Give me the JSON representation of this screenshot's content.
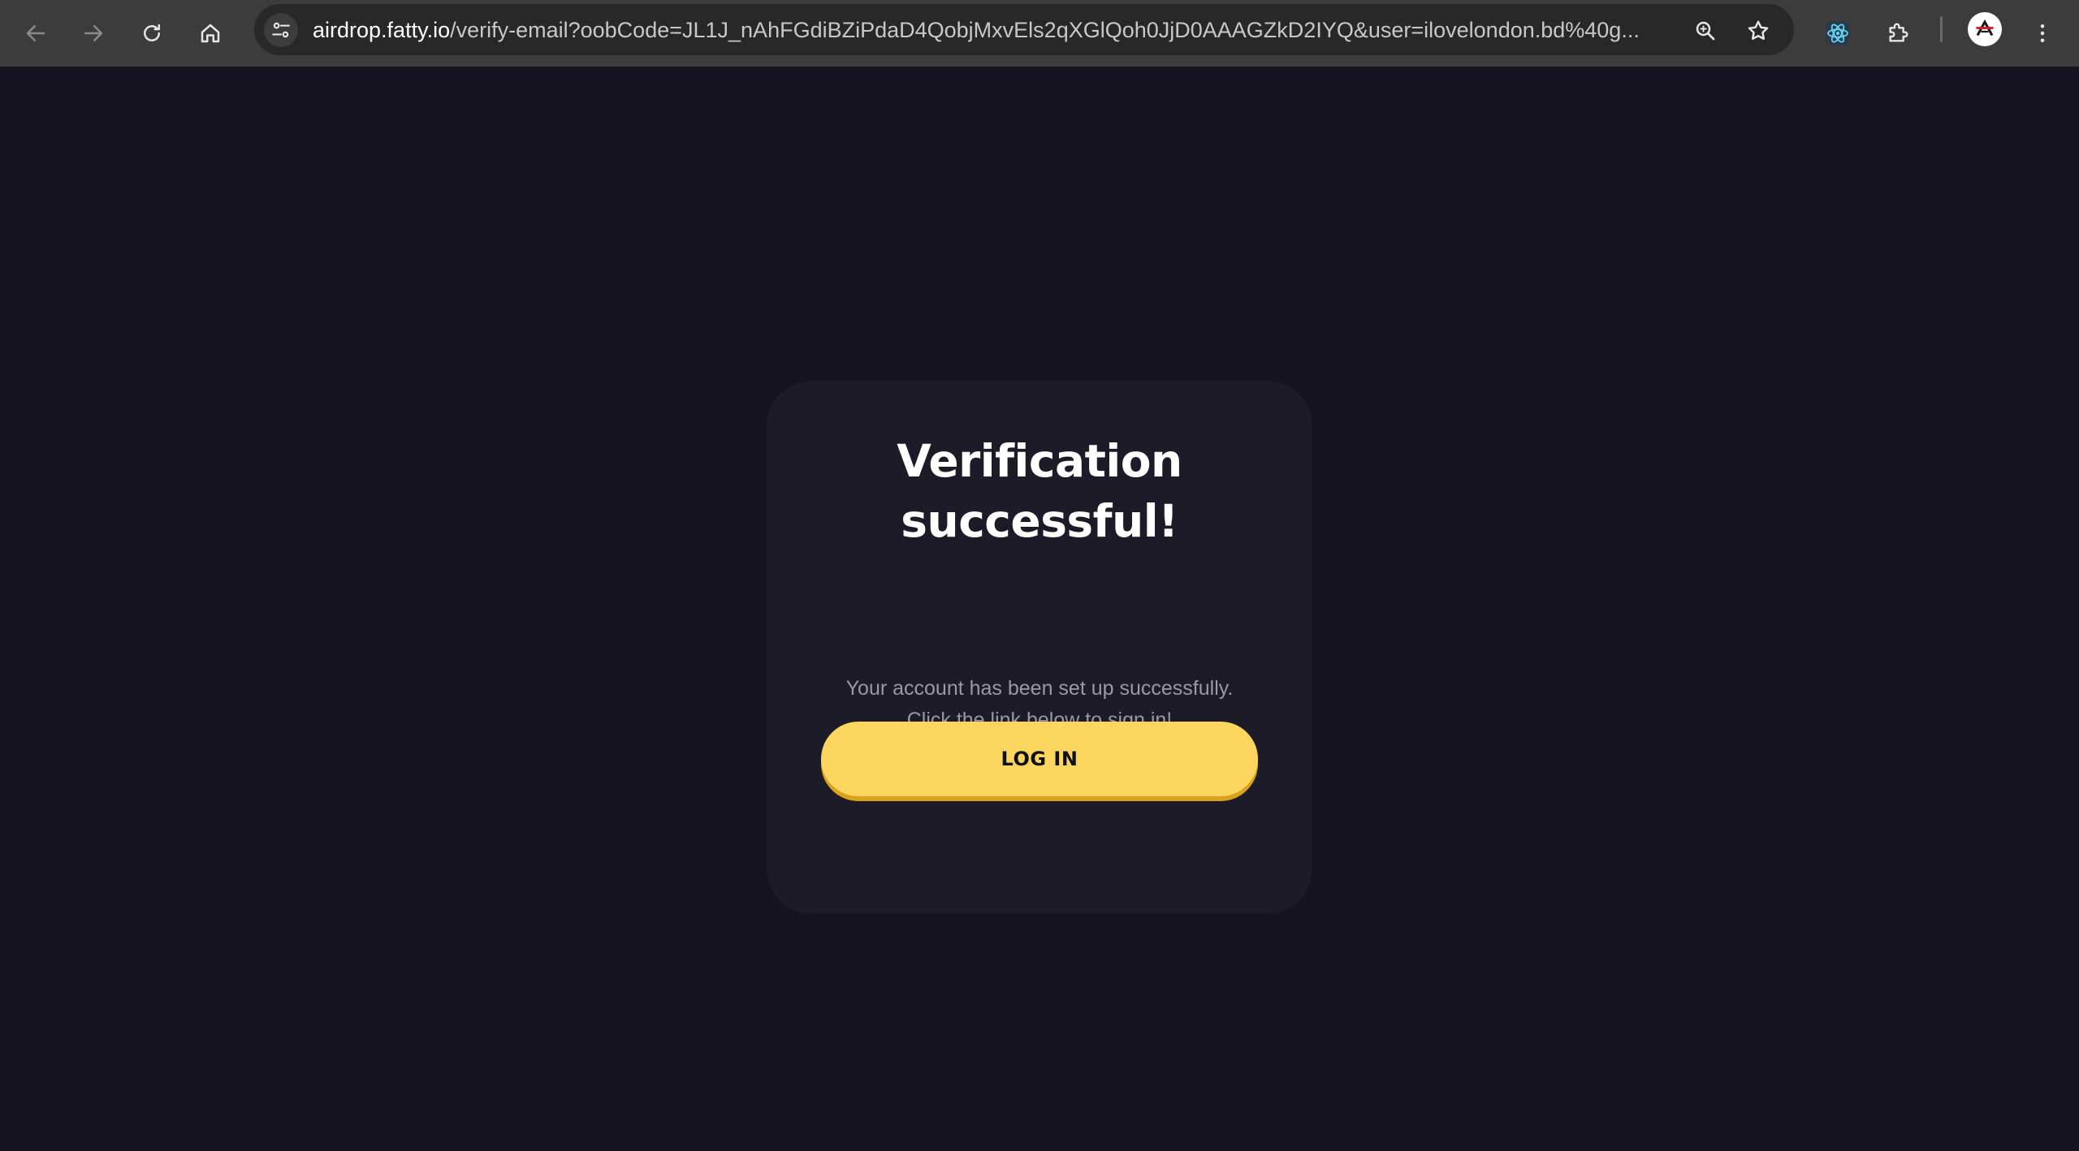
{
  "browser": {
    "url_host": "airdrop.fatty.io",
    "url_path": "/verify-email?oobCode=JL1J_nAhFGdiBZiPdaD4QobjMxvEls2qXGlQoh0JjD0AAAGZkD2IYQ&user=ilovelondon.bd%40g...",
    "icons": {
      "back": "back-arrow-icon",
      "forward": "forward-arrow-icon",
      "reload": "reload-icon",
      "home": "home-icon",
      "site_info": "tune-icon",
      "zoom": "zoom-icon",
      "bookmark": "star-icon",
      "react_devtools": "react-icon",
      "extensions": "puzzle-icon",
      "menu": "kebab-menu-icon"
    }
  },
  "card": {
    "title_line1": "Verification",
    "title_line2": "successful!",
    "message_line1": "Your account has been set up successfully.",
    "message_line2": "Click the link below to sign in!",
    "login_label": "LOG IN"
  },
  "colors": {
    "background": "#16141f",
    "card": "#1d1b27",
    "button": "#fdd65f",
    "button_shadow": "#d9a21b"
  }
}
